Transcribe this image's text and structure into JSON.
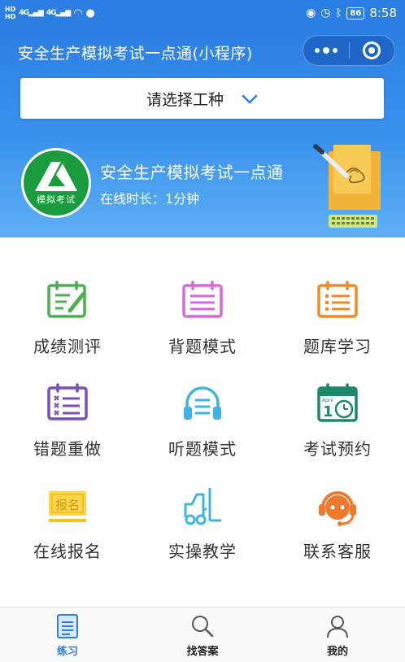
{
  "status_bar": {
    "hd1": "HD",
    "hd2": "HD",
    "signal1": "4G",
    "signal2": "4G",
    "battery": "86",
    "time": "8:58"
  },
  "header": {
    "title": "安全生产模拟考试一点通(小程序)",
    "selector_label": "请选择工种"
  },
  "profile": {
    "logo_text": "模拟考试",
    "app_name": "安全生产模拟考试一点通",
    "online_time": "在线时长：1分钟"
  },
  "menu": [
    {
      "label": "成绩测评",
      "icon": "score-edit-icon",
      "color": "#4caf50"
    },
    {
      "label": "背题模式",
      "icon": "memorize-list-icon",
      "color": "#d86ad8"
    },
    {
      "label": "题库学习",
      "icon": "question-bank-icon",
      "color": "#f08a24"
    },
    {
      "label": "错题重做",
      "icon": "wrong-redo-icon",
      "color": "#7b4fb8"
    },
    {
      "label": "听题模式",
      "icon": "headphones-icon",
      "color": "#3fb4e0"
    },
    {
      "label": "考试预约",
      "icon": "calendar-clock-icon",
      "color": "#1c8a6a"
    },
    {
      "label": "在线报名",
      "icon": "signup-icon",
      "color": "#f4c21b"
    },
    {
      "label": "实操教学",
      "icon": "forklift-icon",
      "color": "#3fb4e0"
    },
    {
      "label": "联系客服",
      "icon": "customer-service-icon",
      "color": "#ef7a2d"
    }
  ],
  "calendar_icon_text": "April",
  "signup_icon_text": "报名",
  "tabbar": [
    {
      "label": "练习",
      "icon": "practice-icon",
      "active": true
    },
    {
      "label": "找答案",
      "icon": "search-icon",
      "active": false
    },
    {
      "label": "我的",
      "icon": "user-icon",
      "active": false
    }
  ],
  "colors": {
    "header_top": "#2b7fe3",
    "header_bottom": "#5eb0f4",
    "accent": "#2b7fe3",
    "logo_green": "#1a9c3e"
  }
}
